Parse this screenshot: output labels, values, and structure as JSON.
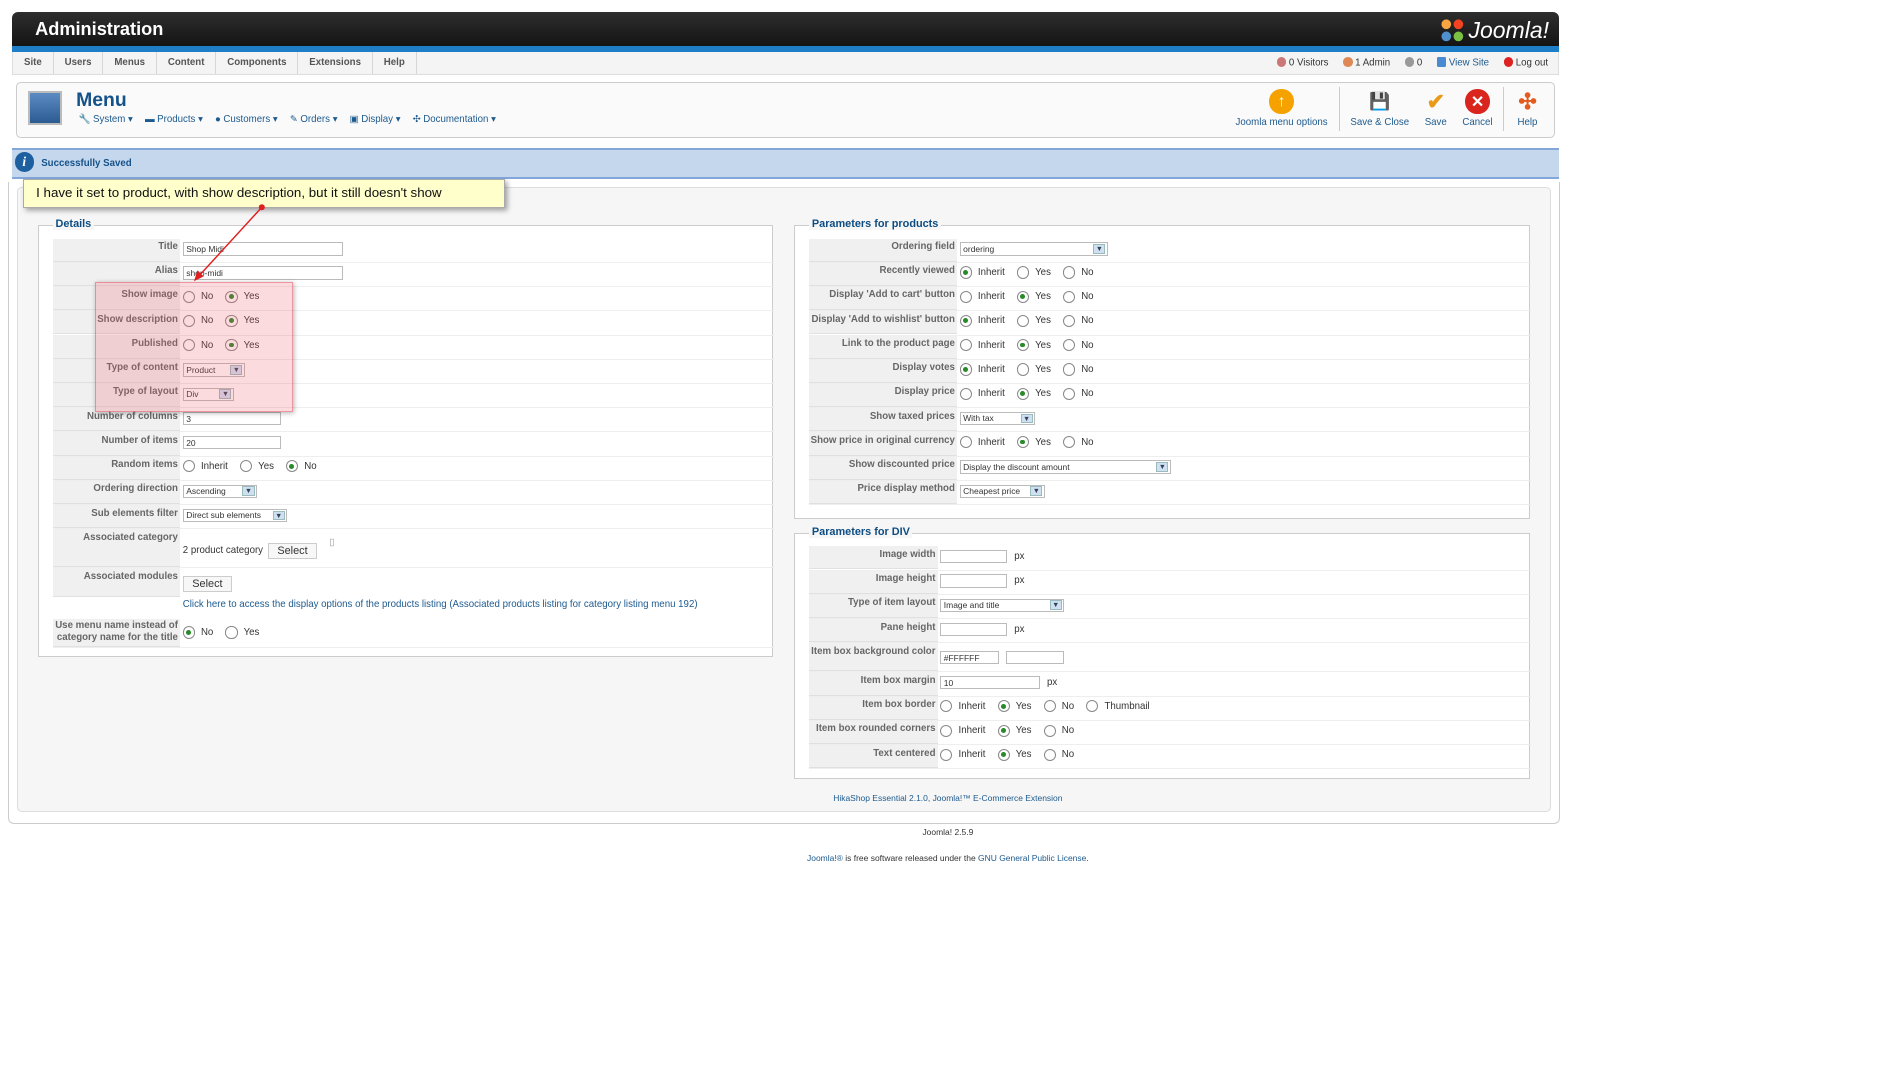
{
  "header": {
    "title": "Administration",
    "brand": "Joomla!"
  },
  "menubar": {
    "items": [
      "Site",
      "Users",
      "Menus",
      "Content",
      "Components",
      "Extensions",
      "Help"
    ],
    "status": {
      "visitors": "0 Visitors",
      "admin": "1 Admin",
      "messages": "0",
      "view_site": "View Site",
      "logout": "Log out"
    }
  },
  "toolbar": {
    "title": "Menu",
    "submenu": [
      "System",
      "Products",
      "Customers",
      "Orders",
      "Display",
      "Documentation"
    ],
    "buttons": {
      "options": "Joomla menu options",
      "save_close": "Save & Close",
      "save": "Save",
      "cancel": "Cancel",
      "help": "Help"
    }
  },
  "message": "Successfully Saved",
  "annotation": "I have it set to product, with show description, but it still doesn't show",
  "details": {
    "legend": "Details",
    "title_label": "Title",
    "title_value": "Shop Midi",
    "alias_label": "Alias",
    "alias_value": "shop-midi",
    "show_image_label": "Show image",
    "show_description_label": "Show description",
    "published_label": "Published",
    "type_content_label": "Type of content",
    "type_content_value": "Product",
    "type_layout_label": "Type of layout",
    "type_layout_value": "Div",
    "columns_label": "Number of columns",
    "columns_value": "3",
    "items_label": "Number of items",
    "items_value": "20",
    "random_label": "Random items",
    "ordering_label": "Ordering direction",
    "ordering_value": "Ascending",
    "sub_label": "Sub elements filter",
    "sub_value": "Direct sub elements",
    "assoc_cat_label": "Associated category",
    "assoc_cat_value": "2 product category",
    "assoc_mod_label": "Associated modules",
    "select": "Select",
    "link": "Click here to access the display options of the products listing (Associated products listing for category listing menu 192)",
    "menu_name_label_1": "Use menu name instead of",
    "menu_name_label_2": "category name for the title",
    "no": "No",
    "yes": "Yes",
    "inherit": "Inherit"
  },
  "params": {
    "legend": "Parameters for products",
    "ordering_field_label": "Ordering field",
    "ordering_field_value": "ordering",
    "recently_viewed": "Recently viewed",
    "add_cart": "Display 'Add to cart' button",
    "add_wishlist": "Display 'Add to wishlist' button",
    "link_product": "Link to the product page",
    "votes": "Display votes",
    "price": "Display price",
    "taxed_label": "Show taxed prices",
    "taxed_value": "With tax",
    "orig_currency": "Show price in original currency",
    "discounted_label": "Show discounted price",
    "discounted_value": "Display the discount amount",
    "price_method_label": "Price display method",
    "price_method_value": "Cheapest price"
  },
  "div": {
    "legend": "Parameters for DIV",
    "img_w": "Image width",
    "img_h": "Image height",
    "px": "px",
    "item_layout_label": "Type of item layout",
    "item_layout_value": "Image and title",
    "pane_h": "Pane height",
    "bg_label": "Item box background color",
    "bg_value": "#FFFFFF",
    "margin_label": "Item box margin",
    "margin_value": "10",
    "border_label": "Item box border",
    "thumbnail": "Thumbnail",
    "rounded_label": "Item box rounded corners",
    "centered_label": "Text centered"
  },
  "footer": {
    "ext": "HikaShop Essential 2.1.0, Joomla!™ E-Commerce Extension",
    "version": "Joomla! 2.5.9",
    "license_a": "Joomla!®",
    "license_b": " is free software released under the ",
    "license_c": "GNU General Public License",
    "license_d": "."
  },
  "colors": {
    "accent": "#1f7ec8",
    "link": "#1d5a8e",
    "save_check": "#e99a18",
    "cancel": "#d9251d",
    "options": "#f5a100"
  }
}
